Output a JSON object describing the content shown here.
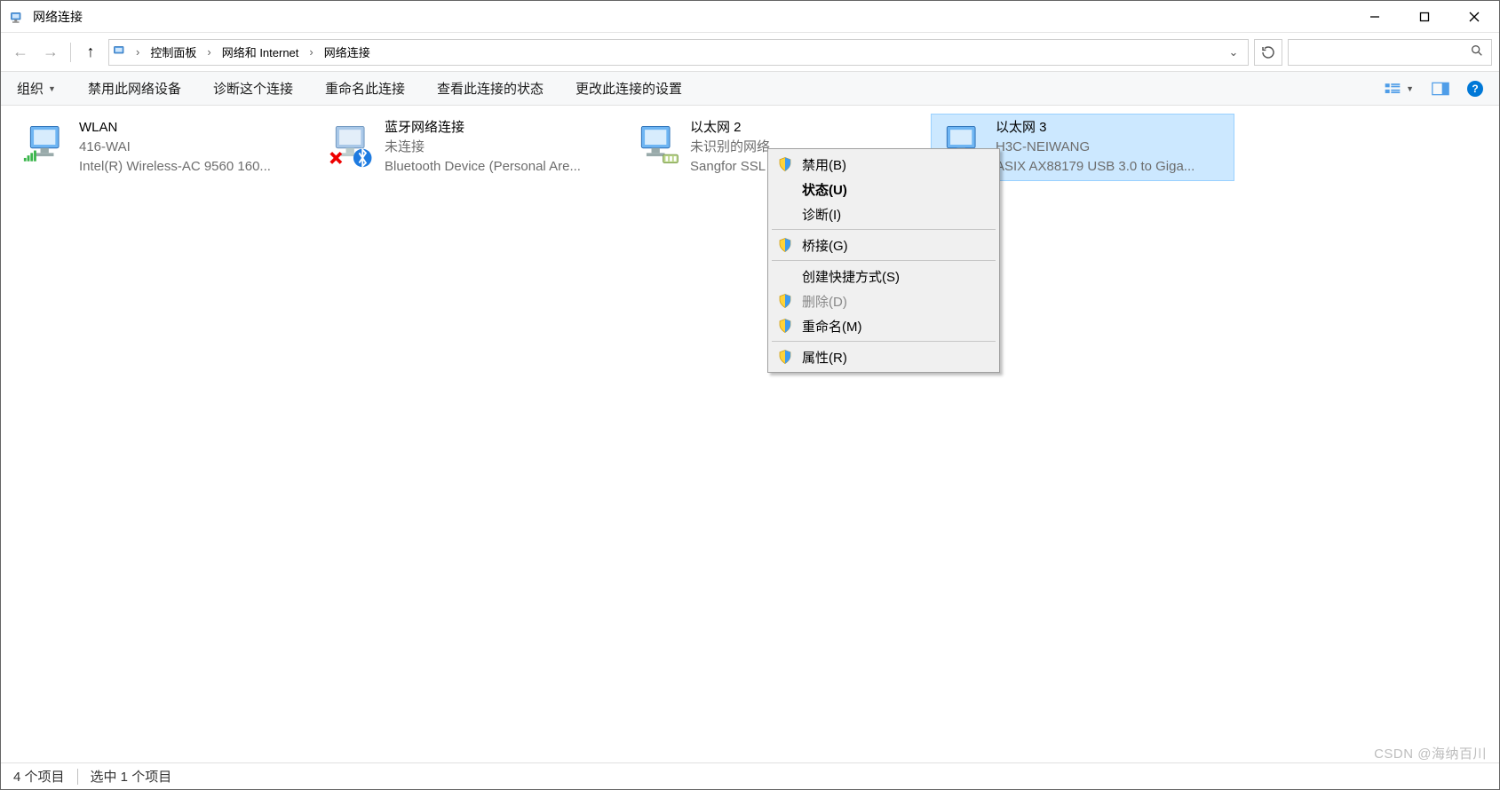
{
  "window": {
    "title": "网络连接"
  },
  "breadcrumbs": {
    "b0": "控制面板",
    "b1": "网络和 Internet",
    "b2": "网络连接"
  },
  "toolbar": {
    "organize": "组织",
    "disable": "禁用此网络设备",
    "diagnose": "诊断这个连接",
    "rename": "重命名此连接",
    "view_status": "查看此连接的状态",
    "change_settings": "更改此连接的设置"
  },
  "connections": [
    {
      "name": "WLAN",
      "status": "416-WAI",
      "device": "Intel(R) Wireless-AC 9560 160...",
      "type": "wifi",
      "disabled": false,
      "selected": false
    },
    {
      "name": "蓝牙网络连接",
      "status": "未连接",
      "device": "Bluetooth Device (Personal Are...",
      "type": "bt",
      "disabled": true,
      "selected": false
    },
    {
      "name": "以太网 2",
      "status": "未识别的网络",
      "device": "Sangfor SSL VPN CS Support Sy...",
      "type": "eth",
      "disabled": false,
      "selected": false
    },
    {
      "name": "以太网 3",
      "status": "H3C-NEIWANG",
      "device": "ASIX AX88179 USB 3.0 to Giga...",
      "type": "eth",
      "disabled": false,
      "selected": true
    }
  ],
  "context_menu": {
    "disable": "禁用(B)",
    "status": "状态(U)",
    "diagnose": "诊断(I)",
    "bridge": "桥接(G)",
    "shortcut": "创建快捷方式(S)",
    "delete": "删除(D)",
    "rename": "重命名(M)",
    "props": "属性(R)"
  },
  "statusbar": {
    "count": "4 个项目",
    "selected": "选中 1 个项目"
  },
  "watermark": "CSDN @海纳百川"
}
